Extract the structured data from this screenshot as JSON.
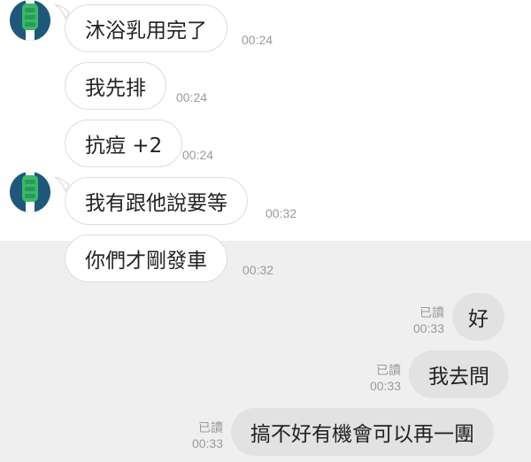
{
  "messages": [
    {
      "side": "in",
      "text": "沐浴乳用完了",
      "time": "00:24"
    },
    {
      "side": "in",
      "text": "我先排",
      "time": "00:24"
    },
    {
      "side": "in",
      "text": "抗痘 +2",
      "time": "00:24"
    },
    {
      "side": "in",
      "text": "我有跟他說要等",
      "time": "00:32"
    },
    {
      "side": "in",
      "text": "你們才剛發車",
      "time": "00:32"
    },
    {
      "side": "out",
      "text": "好",
      "read": "已讀",
      "time": "00:33"
    },
    {
      "side": "out",
      "text": "我去問",
      "read": "已讀",
      "time": "00:33"
    },
    {
      "side": "out",
      "text": "搞不好有機會可以再一團",
      "read": "已讀",
      "time": "00:33"
    }
  ],
  "avatar_icon": "traffic-light-avatar-icon",
  "colors": {
    "avatar_bg": "#1f5878",
    "avatar_fg": "#3bb86a",
    "incoming_bubble": "#ffffff",
    "outgoing_bubble": "#e2e2e2",
    "timestamp": "#9a9a9a"
  }
}
